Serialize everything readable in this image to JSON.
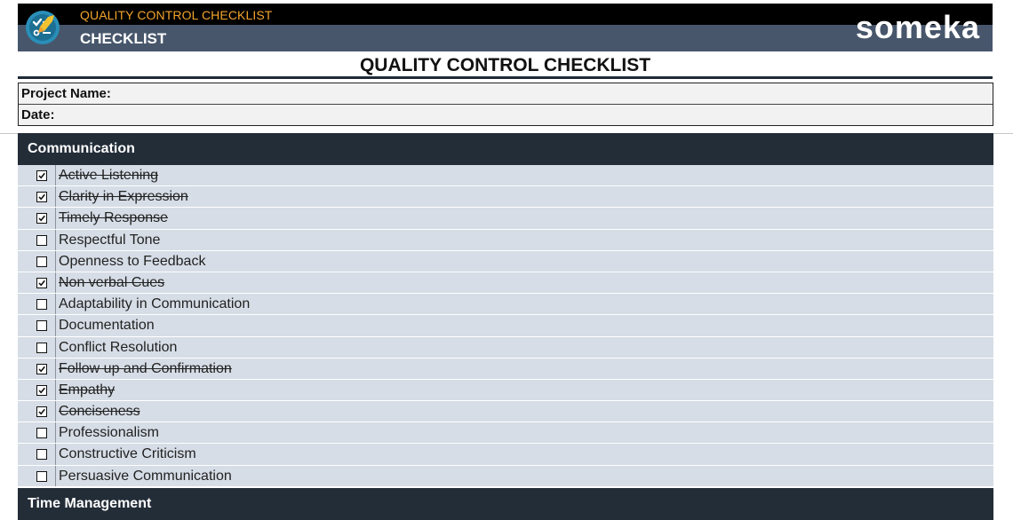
{
  "header": {
    "app_title": "QUALITY CONTROL CHECKLIST",
    "sheet_title": "CHECKLIST",
    "brand_name": "someka"
  },
  "page_title": "QUALITY CONTROL CHECKLIST",
  "project": {
    "name_label": "Project Name:",
    "date_label": "Date:"
  },
  "sections": [
    {
      "title": "Communication",
      "items": [
        {
          "label": "Active Listening",
          "checked": true
        },
        {
          "label": "Clarity in Expression",
          "checked": true
        },
        {
          "label": "Timely Response",
          "checked": true
        },
        {
          "label": "Respectful Tone",
          "checked": false
        },
        {
          "label": "Openness to Feedback",
          "checked": false
        },
        {
          "label": "Non verbal Cues",
          "checked": true
        },
        {
          "label": "Adaptability in Communication",
          "checked": false
        },
        {
          "label": "Documentation",
          "checked": false
        },
        {
          "label": "Conflict Resolution",
          "checked": false
        },
        {
          "label": "Follow up and Confirmation",
          "checked": true
        },
        {
          "label": "Empathy",
          "checked": true
        },
        {
          "label": "Conciseness",
          "checked": true
        },
        {
          "label": "Professionalism",
          "checked": false
        },
        {
          "label": "Constructive Criticism",
          "checked": false
        },
        {
          "label": "Persuasive Communication",
          "checked": false
        }
      ]
    },
    {
      "title": "Time Management",
      "items": []
    }
  ],
  "colors": {
    "banner": "#47566b",
    "section_header": "#232d38",
    "row_fill": "#d6dde6",
    "accent_orange": "#f2a42c"
  },
  "icons": {
    "logo": "checklist-logo-icon",
    "checked": "checked-checkbox-icon",
    "unchecked": "unchecked-checkbox-icon"
  }
}
